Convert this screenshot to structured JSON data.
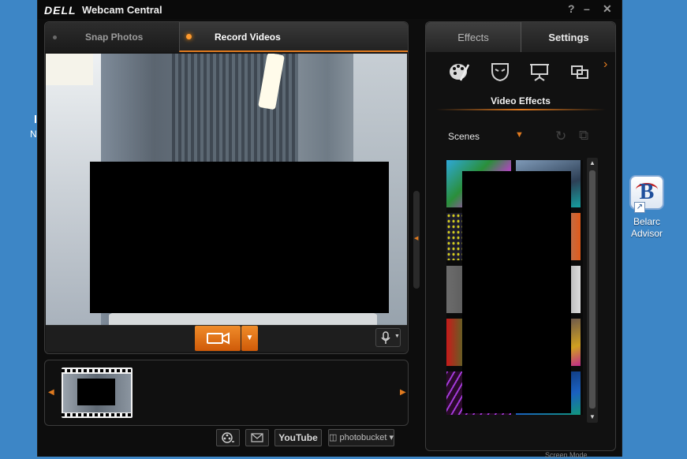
{
  "desktop": {
    "left_fragment": "N",
    "belarc_icon_letter": "B",
    "belarc_label_line1": "Belarc",
    "belarc_label_line2": "Advisor"
  },
  "window": {
    "logo": "DELL",
    "title": "Webcam Central",
    "help": "?",
    "minimize": "–",
    "close": "✕"
  },
  "tabs": {
    "snap": "Snap Photos",
    "record": "Record Videos"
  },
  "right_tabs": {
    "effects": "Effects",
    "settings": "Settings"
  },
  "effects": {
    "title": "Video Effects",
    "scenes_label": "Scenes",
    "more_arrow": "›"
  },
  "share": {
    "youtube": "YouTube",
    "photobucket": "photobucket"
  },
  "colors": {
    "accent": "#e07a1f",
    "record_button": "#e87a1c",
    "window_bg": "#0d0d0d",
    "desktop_bg": "#3d86c6"
  },
  "icons": {
    "effects": [
      "palette-icon",
      "avatar-mask-icon",
      "presentation-icon",
      "overlay-frames-icon"
    ],
    "record": "video-camera-icon",
    "mic": "microphone-icon",
    "share": [
      "film-reel-icon",
      "email-icon"
    ]
  },
  "bottom_fragment": "Screen Mode"
}
